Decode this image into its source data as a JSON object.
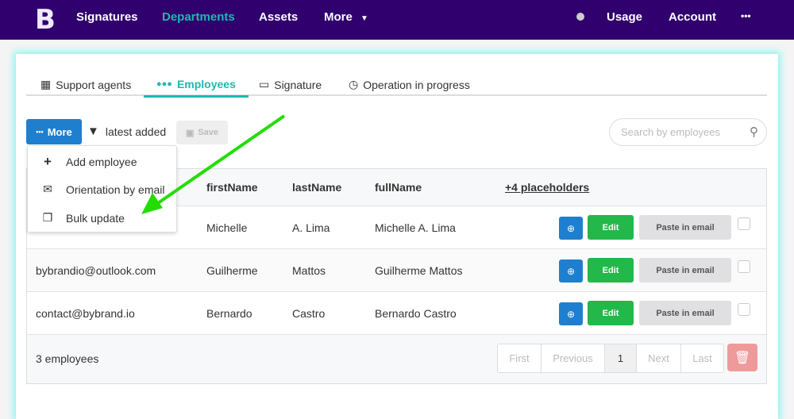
{
  "nav": {
    "logo": "B",
    "items": [
      "Signatures",
      "Departments",
      "Assets",
      "More"
    ],
    "right": [
      "Usage",
      "Account",
      "•••"
    ]
  },
  "tabs": [
    "Support agents",
    "Employees",
    "Signature",
    "Operation in progress"
  ],
  "toolbar": {
    "more": "More",
    "filter": "latest added",
    "save": "Save",
    "search_placeholder": "Search by employees"
  },
  "menu": [
    "Add employee",
    "Orientation by email",
    "Bulk update"
  ],
  "table": {
    "headers": [
      "firstName",
      "lastName",
      "fullName",
      "+4 placeholders"
    ],
    "rows": [
      {
        "email": "",
        "first": "Michelle",
        "last": "A. Lima",
        "full": "Michelle A. Lima"
      },
      {
        "email": "bybrandio@outlook.com",
        "first": "Guilherme",
        "last": "Mattos",
        "full": "Guilherme Mattos"
      },
      {
        "email": "contact@bybrand.io",
        "first": "Bernardo",
        "last": "Castro",
        "full": "Bernardo Castro"
      }
    ],
    "actions": {
      "edit": "Edit",
      "paste": "Paste in email"
    },
    "count": "3 employees",
    "pager": [
      "First",
      "Previous",
      "1",
      "Next",
      "Last"
    ]
  },
  "colors": {
    "nav": "#30006e",
    "accent": "#1fb8b0",
    "primary": "#1f7fcf",
    "success": "#22b84a",
    "arrow": "#22dd00"
  }
}
